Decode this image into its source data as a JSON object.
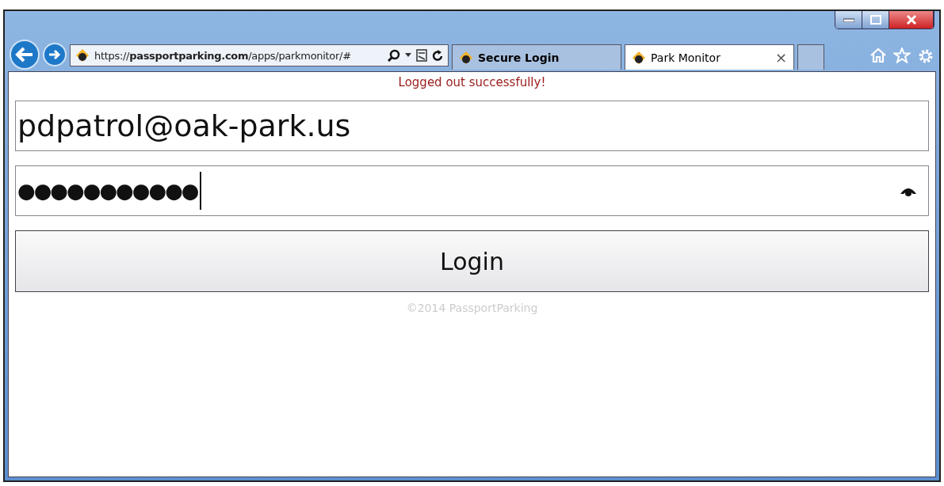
{
  "browser": {
    "address": "https://**passportparking.com**/apps/parkmonitor/#",
    "tabs": [
      {
        "label": "Secure Login",
        "selected": false
      },
      {
        "label": "Park Monitor",
        "selected": true,
        "close": "×"
      }
    ]
  },
  "page": {
    "message": "Logged out successfully!",
    "email": "pdpatrol@oak-park.us",
    "password_mask": "●●●●●●●●●●●",
    "login_button": "Login",
    "footer": "©2014 PassportParking"
  }
}
